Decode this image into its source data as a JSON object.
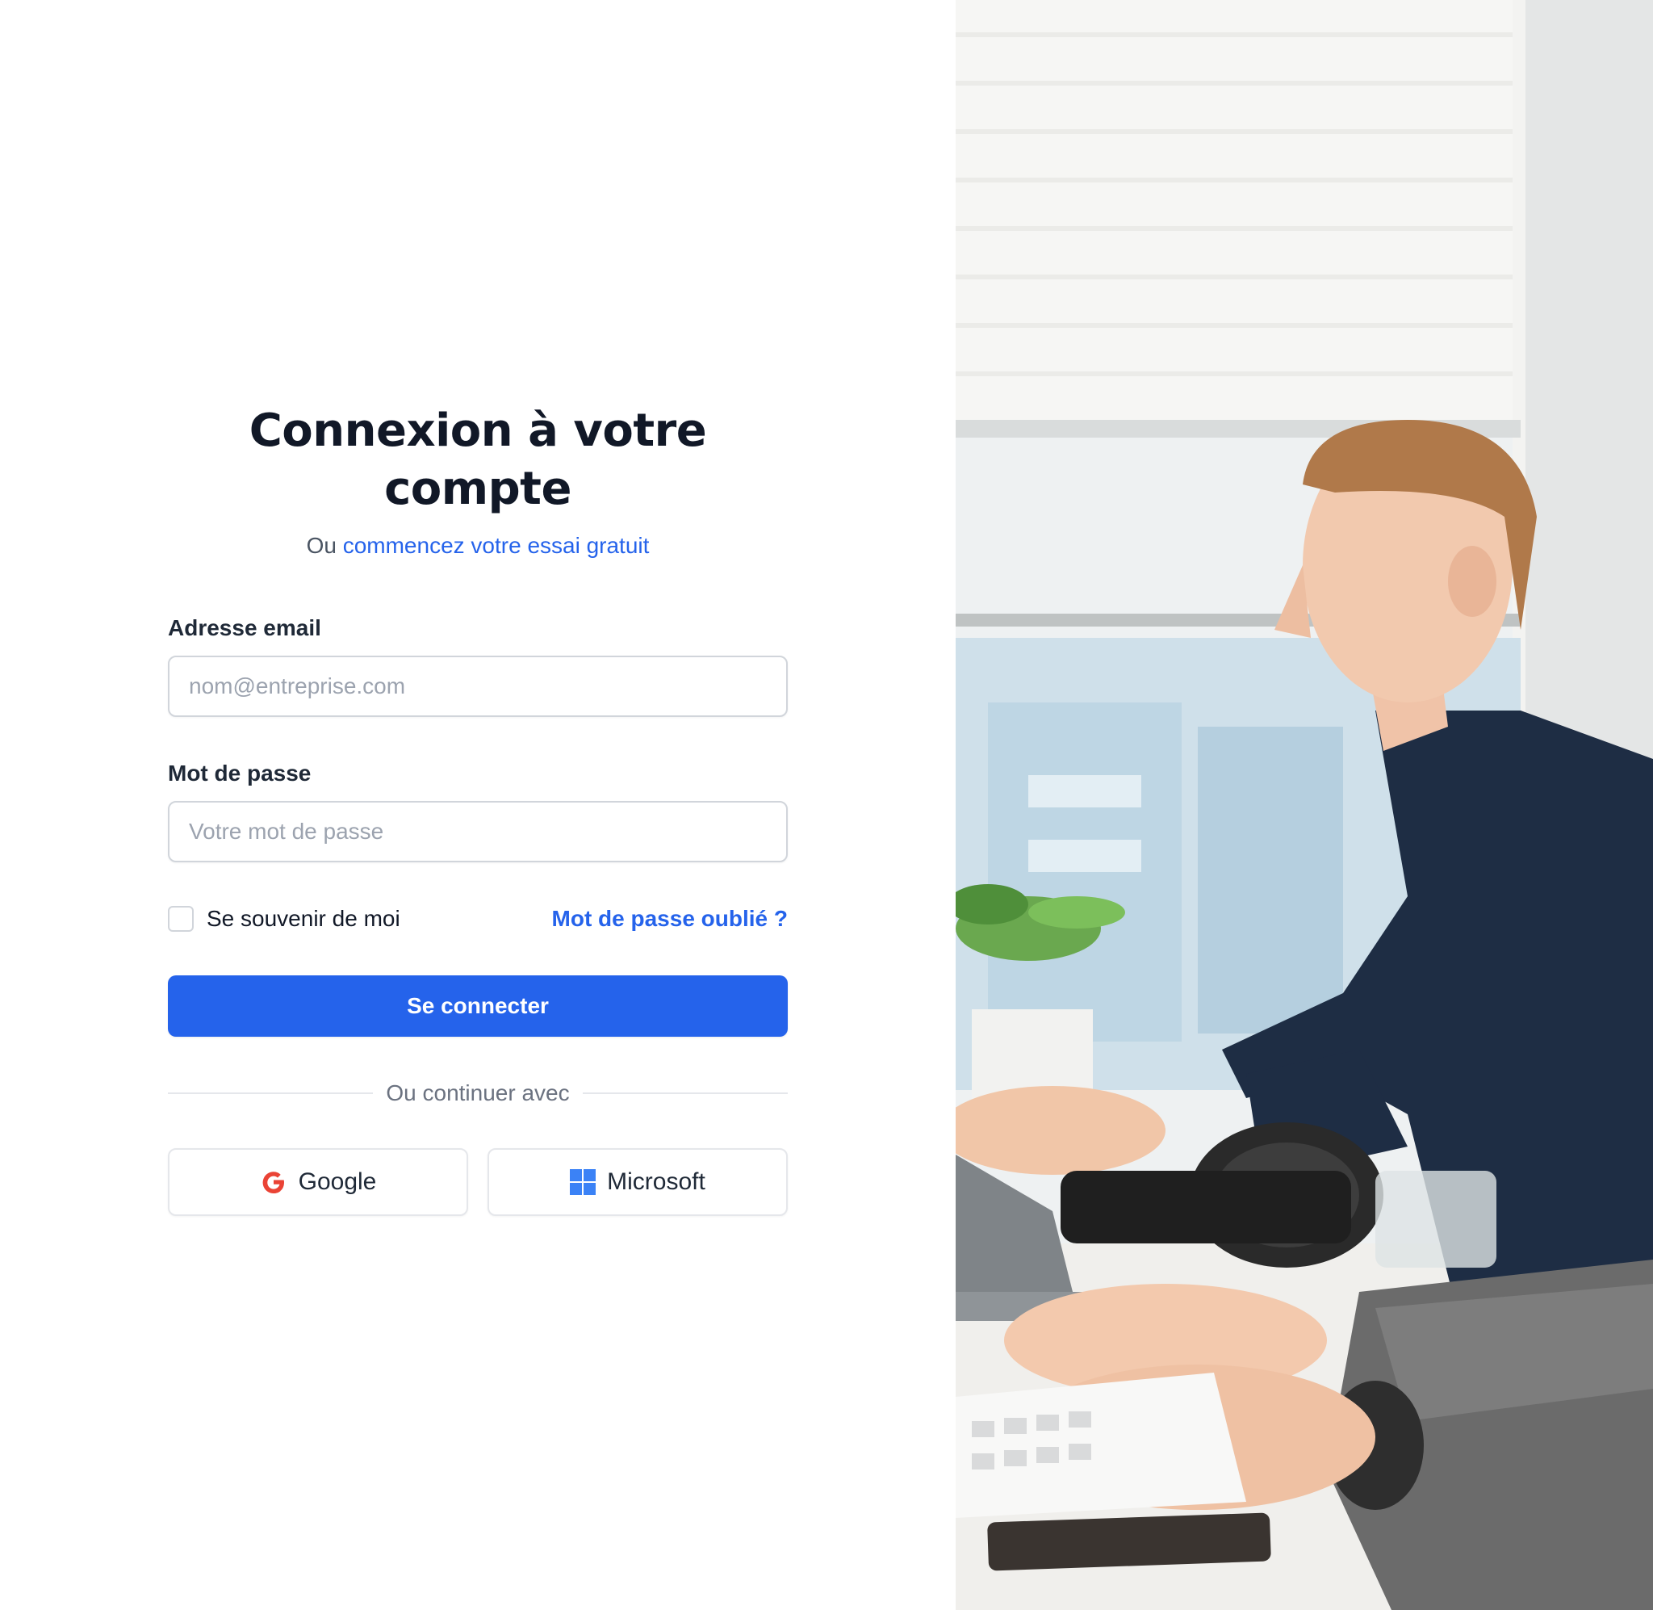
{
  "login": {
    "title": "Connexion à votre compte",
    "subtitle_prefix": "Ou",
    "trial_link": "commencez votre essai gratuit",
    "email_label": "Adresse email",
    "email_placeholder": "nom@entreprise.com",
    "email_value": "",
    "password_label": "Mot de passe",
    "password_placeholder": "Votre mot de passe",
    "password_value": "",
    "remember_label": "Se souvenir de moi",
    "remember_checked": false,
    "forgot_link": "Mot de passe oublié ?",
    "submit_label": "Se connecter",
    "divider_text": "Ou continuer avec",
    "social": {
      "google_label": "Google",
      "google_icon": "google-icon",
      "microsoft_label": "Microsoft",
      "microsoft_icon": "microsoft-icon"
    }
  },
  "colors": {
    "accent": "#2563eb",
    "title": "#111827",
    "border": "#d1d5db"
  }
}
